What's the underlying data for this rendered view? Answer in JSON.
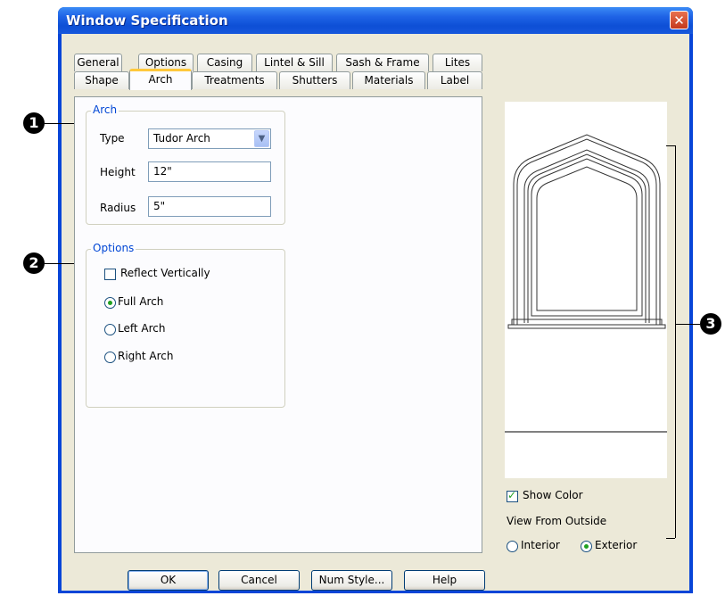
{
  "window": {
    "title": "Window Specification",
    "close_glyph": "✕"
  },
  "tabs": {
    "row1": [
      "General",
      "Options",
      "Casing",
      "Lintel & Sill",
      "Sash & Frame",
      "Lites"
    ],
    "row2": [
      "Shape",
      "Arch",
      "Treatments",
      "Shutters",
      "Materials",
      "Label"
    ],
    "active": "Arch"
  },
  "arch_group": {
    "label": "Arch",
    "type_label": "Type",
    "type_value": "Tudor Arch",
    "height_label": "Height",
    "height_value": "12\"",
    "radius_label": "Radius",
    "radius_value": "5\""
  },
  "options_group": {
    "label": "Options",
    "reflect_label": "Reflect Vertically",
    "reflect_checked": false,
    "radios": [
      "Full Arch",
      "Left Arch",
      "Right Arch"
    ],
    "selected": "Full Arch"
  },
  "preview": {
    "show_color_label": "Show Color",
    "show_color_checked": true,
    "view_from_outside_label": "View From Outside",
    "interior_label": "Interior",
    "exterior_label": "Exterior",
    "selected_view": "Exterior"
  },
  "buttons": {
    "ok": "OK",
    "cancel": "Cancel",
    "num_style": "Num Style...",
    "help": "Help"
  },
  "callouts": [
    "1",
    "2",
    "3"
  ],
  "icons": {
    "close": "close-icon",
    "dropdown": "chevron-down-icon"
  }
}
